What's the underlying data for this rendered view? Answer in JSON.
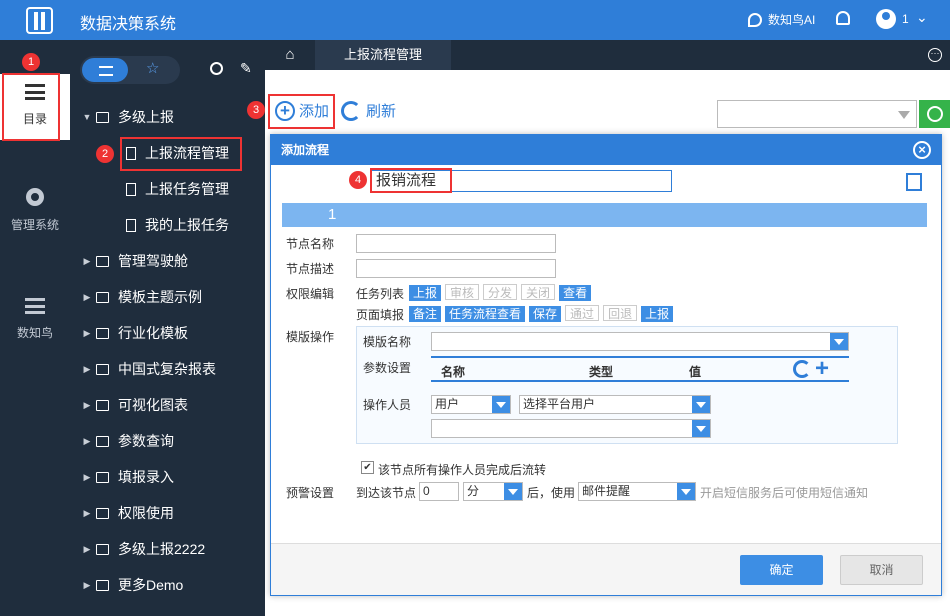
{
  "app": {
    "title": "数据决策系统",
    "ai_label": "数知鸟AI",
    "user_count": "1"
  },
  "leftnav": [
    {
      "label": "目录"
    },
    {
      "label": "管理系统"
    },
    {
      "label": "数知鸟"
    }
  ],
  "tree": {
    "items": [
      {
        "label": "多级上报"
      },
      {
        "label": "上报流程管理"
      },
      {
        "label": "上报任务管理"
      },
      {
        "label": "我的上报任务"
      },
      {
        "label": "管理驾驶舱"
      },
      {
        "label": "模板主题示例"
      },
      {
        "label": "行业化模板"
      },
      {
        "label": "中国式复杂报表"
      },
      {
        "label": "可视化图表"
      },
      {
        "label": "参数查询"
      },
      {
        "label": "填报录入"
      },
      {
        "label": "权限使用"
      },
      {
        "label": "多级上报2222"
      },
      {
        "label": "更多Demo"
      }
    ]
  },
  "tabs": {
    "active": "上报流程管理"
  },
  "toolbar": {
    "add_label": "添加",
    "refresh_label": "刷新"
  },
  "badges": [
    "1",
    "2",
    "3",
    "4"
  ],
  "dialog": {
    "title": "添加流程",
    "flow_name": "报销流程",
    "step": "1",
    "node_name_label": "节点名称",
    "node_desc_label": "节点描述",
    "perm_label": "权限编辑",
    "task_list_label": "任务列表",
    "task_list_chips": [
      {
        "label": "上报",
        "on": true
      },
      {
        "label": "审核",
        "on": false
      },
      {
        "label": "分发",
        "on": false
      },
      {
        "label": "关闭",
        "on": false
      },
      {
        "label": "查看",
        "on": true
      }
    ],
    "page_fill_label": "页面填报",
    "page_fill_chips": [
      {
        "label": "备注",
        "on": true
      },
      {
        "label": "任务流程查看",
        "on": true
      },
      {
        "label": "保存",
        "on": true
      },
      {
        "label": "通过",
        "on": false
      },
      {
        "label": "回退",
        "on": false
      },
      {
        "label": "上报",
        "on": true
      }
    ],
    "tpl_op_label": "模版操作",
    "tpl_name_label": "模版名称",
    "param_label": "参数设置",
    "param_cols": [
      "名称",
      "类型",
      "值"
    ],
    "operator_label": "操作人员",
    "operator_type": "用户",
    "operator_select": "选择平台用户",
    "check_label": "该节点所有操作人员完成后流转",
    "warn_label": "预警设置",
    "reach_label": "到达该节点",
    "reach_value": "0",
    "unit": "分",
    "after_label": "后，使用",
    "notify_method": "邮件提醒",
    "notify_hint": "开启短信服务后可使用短信通知",
    "ok_label": "确定",
    "cancel_label": "取消"
  }
}
